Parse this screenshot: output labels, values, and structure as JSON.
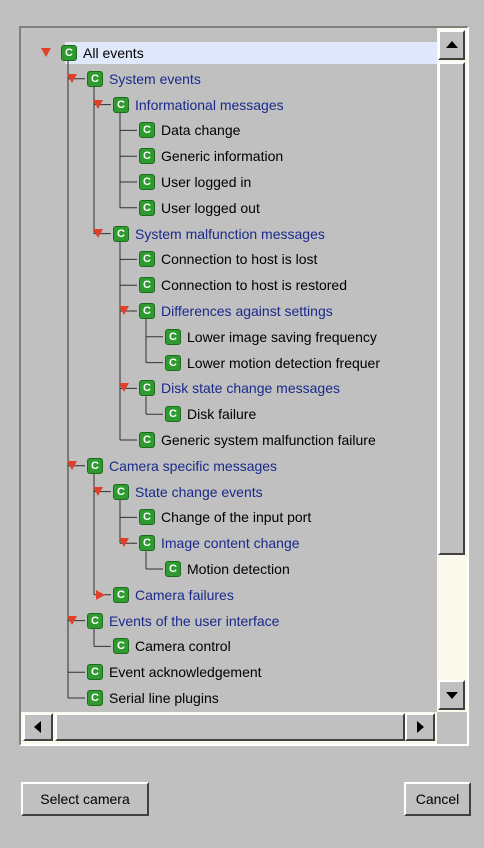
{
  "tree": {
    "items": [
      {
        "label": "All events",
        "level": 0,
        "expanded": true,
        "selected": true
      },
      {
        "label": "System events",
        "level": 1,
        "expanded": true
      },
      {
        "label": "Informational messages",
        "level": 2,
        "expanded": true
      },
      {
        "label": "Data change",
        "level": 3
      },
      {
        "label": "Generic information",
        "level": 3
      },
      {
        "label": "User logged in",
        "level": 3
      },
      {
        "label": "User logged out",
        "level": 3
      },
      {
        "label": "System malfunction messages",
        "level": 2,
        "expanded": true
      },
      {
        "label": "Connection to host is lost",
        "level": 3
      },
      {
        "label": "Connection to host is restored",
        "level": 3
      },
      {
        "label": "Differences against settings",
        "level": 3,
        "expanded": true
      },
      {
        "label": "Lower image saving frequency",
        "level": 4
      },
      {
        "label": "Lower motion detection frequer",
        "level": 4
      },
      {
        "label": "Disk state change messages",
        "level": 3,
        "expanded": true
      },
      {
        "label": "Disk failure",
        "level": 4
      },
      {
        "label": "Generic system malfunction failure",
        "level": 3
      },
      {
        "label": "Camera specific messages",
        "level": 1,
        "expanded": true
      },
      {
        "label": "State change events",
        "level": 2,
        "expanded": true
      },
      {
        "label": "Change of the input port",
        "level": 3
      },
      {
        "label": "Image content change",
        "level": 3,
        "expanded": true
      },
      {
        "label": "Motion detection",
        "level": 4
      },
      {
        "label": "Camera failures",
        "level": 2,
        "expanded": false
      },
      {
        "label": "Events of the user interface",
        "level": 1,
        "expanded": true
      },
      {
        "label": "Camera control",
        "level": 2
      },
      {
        "label": "Event acknowledgement",
        "level": 1
      },
      {
        "label": "Serial line plugins",
        "level": 1
      }
    ],
    "node_icon_letter": "C"
  },
  "buttons": {
    "select_camera": "Select camera",
    "cancel": "Cancel"
  },
  "colors": {
    "background": "#c0c0c0",
    "expand_triangle": "#e0402a",
    "node_icon": "#2f9a2f",
    "group_label": "#1a2a8a",
    "leaf_label": "#000000",
    "selection": "#e0e8fc",
    "scroll_track": "#fbf9ec"
  },
  "icons": {
    "expanded": "triangle-down-icon",
    "collapsed": "triangle-right-icon",
    "node": "c-node-icon",
    "scroll_up": "arrow-up-icon",
    "scroll_down": "arrow-down-icon",
    "scroll_left": "arrow-left-icon",
    "scroll_right": "arrow-right-icon"
  }
}
